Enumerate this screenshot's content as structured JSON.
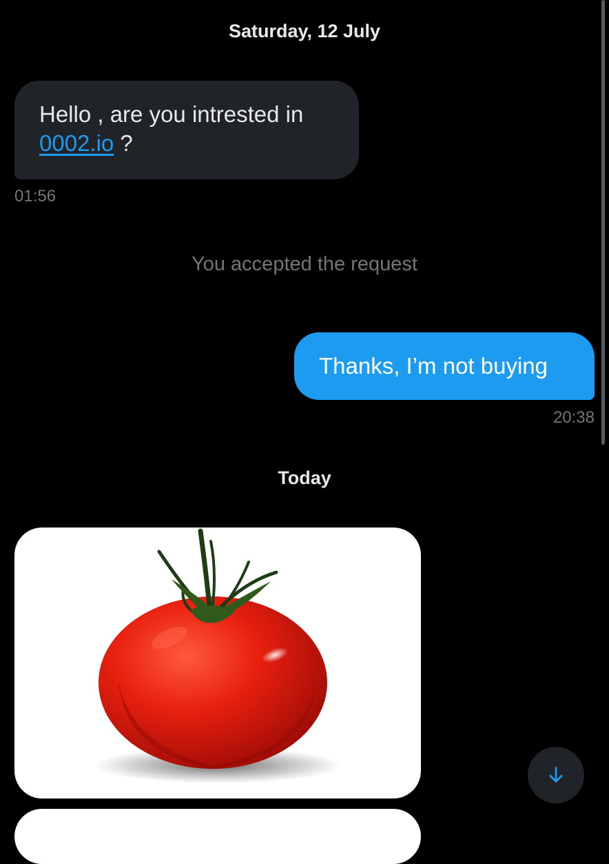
{
  "conversation": {
    "date_header_1": "Saturday, 12 July",
    "message_1": {
      "text_before_link": "Hello , are you intrested in ",
      "link_text": "0002.io",
      "text_after_link": " ?",
      "time": "01:56"
    },
    "system_note": "You accepted the request",
    "message_2": {
      "text": "Thanks, I’m not buying",
      "time": "20:38"
    },
    "date_header_2": "Today"
  },
  "media": {
    "image_1_icon": "tomato-image",
    "image_2_icon": "image-attachment"
  },
  "controls": {
    "scroll_down_icon": "arrow-down-icon"
  },
  "colors": {
    "background": "#000000",
    "incoming_bubble": "#202327",
    "outgoing_bubble": "#1d9bf0",
    "link": "#1d9bf0",
    "muted_text": "#71767b"
  }
}
